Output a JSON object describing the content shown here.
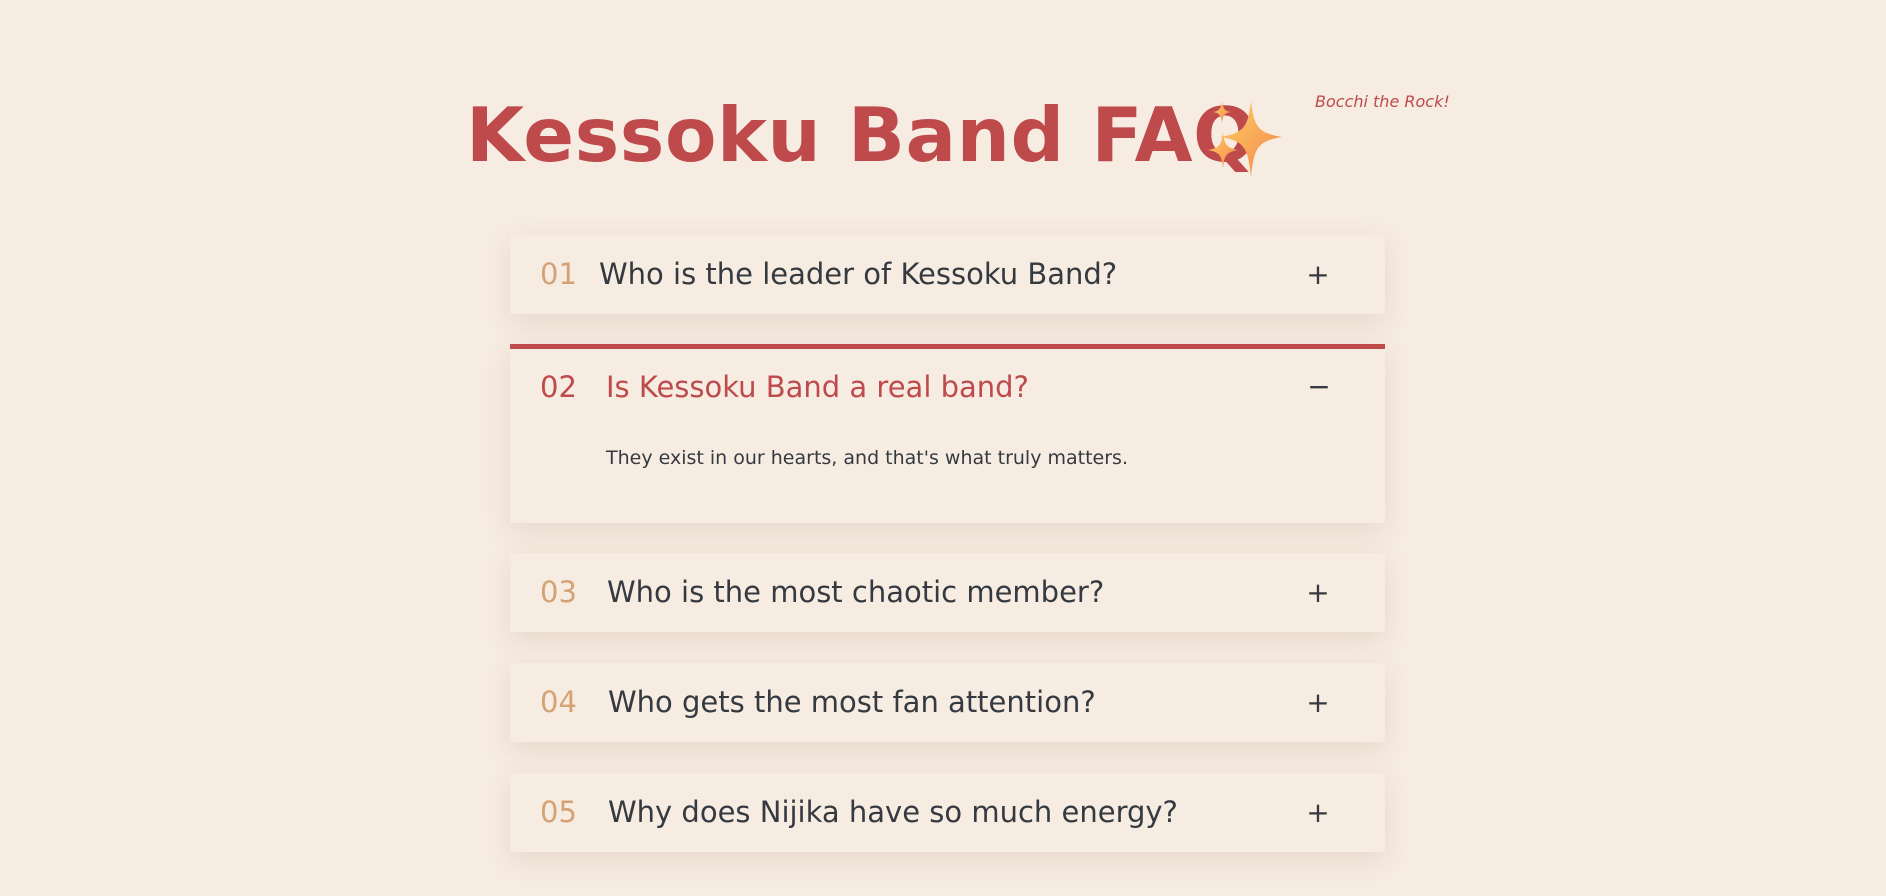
{
  "header": {
    "title": "Kessoku Band FAQ",
    "subtitle": "Bocchi the Rock!",
    "title_icon": "sparkles-icon"
  },
  "colors": {
    "background": "#f7ece2",
    "accent": "#be4a4c",
    "number": "#d4a274",
    "text": "#343a40"
  },
  "faq": {
    "items": [
      {
        "number": "01",
        "question": "Who is the leader of Kessoku Band?",
        "toggle": "+",
        "expanded": false
      },
      {
        "number": "02",
        "question": "Is Kessoku Band a real band?",
        "toggle": "−",
        "expanded": true,
        "answer": "They exist in our hearts, and that's what truly matters."
      },
      {
        "number": "03",
        "question": "Who is the most chaotic member?",
        "toggle": "+",
        "expanded": false
      },
      {
        "number": "04",
        "question": "Who gets the most fan attention?",
        "toggle": "+",
        "expanded": false
      },
      {
        "number": "05",
        "question": "Why does Nijika have so much energy?",
        "toggle": "+",
        "expanded": false
      }
    ]
  }
}
